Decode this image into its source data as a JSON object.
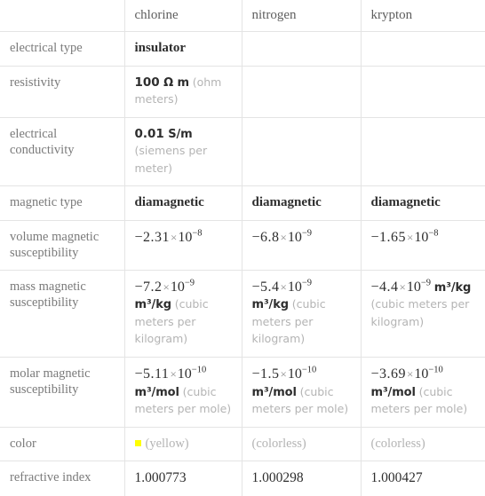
{
  "table": {
    "columns": [
      "",
      "chlorine",
      "nitrogen",
      "krypton"
    ],
    "rows": [
      {
        "label": "electrical type",
        "cells": [
          {
            "kind": "bold-serif",
            "text": "insulator"
          },
          {
            "kind": "empty",
            "text": ""
          },
          {
            "kind": "empty",
            "text": ""
          }
        ]
      },
      {
        "label": "resistivity",
        "cells": [
          {
            "kind": "unit-value",
            "number": "100",
            "unit": "Ω m",
            "note": "(ohm meters)"
          },
          {
            "kind": "empty",
            "text": ""
          },
          {
            "kind": "empty",
            "text": ""
          }
        ]
      },
      {
        "label": "electrical conductivity",
        "cells": [
          {
            "kind": "unit-value",
            "number": "0.01",
            "unit": "S/m",
            "note": "(siemens per meter)"
          },
          {
            "kind": "empty",
            "text": ""
          },
          {
            "kind": "empty",
            "text": ""
          }
        ]
      },
      {
        "label": "magnetic type",
        "cells": [
          {
            "kind": "bold-serif",
            "text": "diamagnetic"
          },
          {
            "kind": "bold-serif",
            "text": "diamagnetic"
          },
          {
            "kind": "bold-serif",
            "text": "diamagnetic"
          }
        ]
      },
      {
        "label": "volume magnetic susceptibility",
        "cells": [
          {
            "kind": "sci",
            "mantissa": "−2.31",
            "exponent": "−8",
            "unit": "",
            "note": ""
          },
          {
            "kind": "sci",
            "mantissa": "−6.8",
            "exponent": "−9",
            "unit": "",
            "note": ""
          },
          {
            "kind": "sci",
            "mantissa": "−1.65",
            "exponent": "−8",
            "unit": "",
            "note": ""
          }
        ]
      },
      {
        "label": "mass magnetic susceptibility",
        "cells": [
          {
            "kind": "sci",
            "mantissa": "−7.2",
            "exponent": "−9",
            "unit": "m³/kg",
            "note": "(cubic meters per kilogram)"
          },
          {
            "kind": "sci",
            "mantissa": "−5.4",
            "exponent": "−9",
            "unit": "m³/kg",
            "note": "(cubic meters per kilogram)"
          },
          {
            "kind": "sci",
            "mantissa": "−4.4",
            "exponent": "−9",
            "unit": "m³/kg",
            "note": "(cubic meters per kilogram)"
          }
        ]
      },
      {
        "label": "molar magnetic susceptibility",
        "cells": [
          {
            "kind": "sci",
            "mantissa": "−5.11",
            "exponent": "−10",
            "unit": "m³/mol",
            "note": "(cubic meters per mole)"
          },
          {
            "kind": "sci",
            "mantissa": "−1.5",
            "exponent": "−10",
            "unit": "m³/mol",
            "note": "(cubic meters per mole)"
          },
          {
            "kind": "sci",
            "mantissa": "−3.69",
            "exponent": "−10",
            "unit": "m³/mol",
            "note": "(cubic meters per mole)"
          }
        ]
      },
      {
        "label": "color",
        "cells": [
          {
            "kind": "color",
            "swatch": "#ffff00",
            "text": "(yellow)"
          },
          {
            "kind": "color",
            "swatch": "",
            "text": "(colorless)"
          },
          {
            "kind": "color",
            "swatch": "",
            "text": "(colorless)"
          }
        ]
      },
      {
        "label": "refractive index",
        "cells": [
          {
            "kind": "plain",
            "text": "1.000773"
          },
          {
            "kind": "plain",
            "text": "1.000298"
          },
          {
            "kind": "plain",
            "text": "1.000427"
          }
        ]
      }
    ]
  }
}
